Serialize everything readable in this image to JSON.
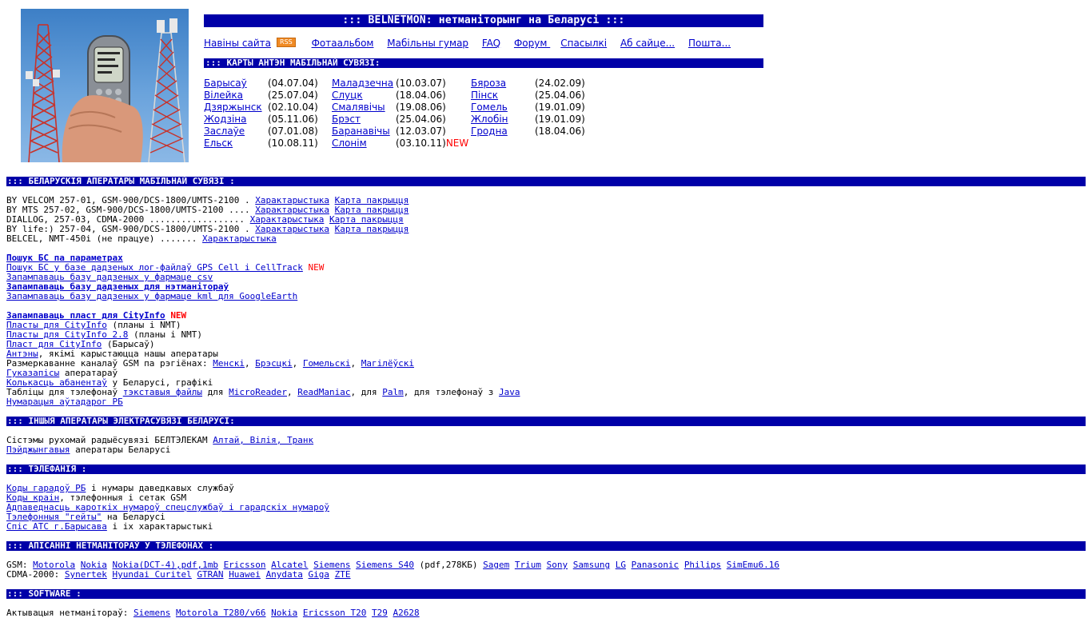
{
  "header": {
    "title": "::: BELNETMON: нетманіторынг на Беларусі :::",
    "nav": [
      "Навіны сайта",
      "Фотаальбом",
      "Мабільны гумар",
      "FAQ",
      "Форум ",
      "Спасылкі",
      "Аб сайце...",
      "Пошта..."
    ],
    "rss_label": "RSS",
    "maps_title": "::: КАРТЫ АНТЭН МАБІЛЬНАЙ СУВЯЗІ:"
  },
  "cities": {
    "col1": [
      {
        "name": "Барысаў",
        "date": "(04.07.04)"
      },
      {
        "name": "Вілейка",
        "date": "(25.07.04)"
      },
      {
        "name": "Дзяржынск",
        "date": "(02.10.04)"
      },
      {
        "name": "Жодзіна",
        "date": "(05.11.06)"
      },
      {
        "name": "Заслаўе",
        "date": "(07.01.08)"
      },
      {
        "name": "Ельск",
        "date": "(10.08.11)"
      }
    ],
    "col2": [
      {
        "name": "Маладзечна",
        "date": "(10.03.07)"
      },
      {
        "name": "Слуцк",
        "date": "(18.04.06)"
      },
      {
        "name": "Смалявічы",
        "date": "(19.08.06)"
      },
      {
        "name": "Брэст",
        "date": "(25.04.06)"
      },
      {
        "name": "Баранавічы",
        "date": "(12.03.07)"
      },
      {
        "name": "Слонім",
        "date": "(03.10.11)"
      }
    ],
    "col3": [
      {
        "name": "Бяроза",
        "date": "(24.02.09)"
      },
      {
        "name": "Пінск",
        "date": "(25.04.06)"
      },
      {
        "name": "Гомель",
        "date": "(19.01.09)"
      },
      {
        "name": "Жлобін",
        "date": "(19.01.09)"
      },
      {
        "name": "Гродна",
        "date": "(18.04.06)"
      }
    ],
    "new_label": "NEW"
  },
  "operators": {
    "title": "::: БЕЛАРУСКІЯ АПЕРАТАРЫ МАБІЛЬНАЙ СУВЯЗІ :",
    "rows": [
      {
        "text": "BY VELCOM 257-01, GSM-900/DCS-1800/UMTS-2100 . ",
        "link1": "Характарыстыка",
        "link2": "Карта пакрыцця"
      },
      {
        "text": "BY MTS 257-02, GSM-900/DCS-1800/UMTS-2100 .... ",
        "link1": "Характарыстыка",
        "link2": "Карта пакрыцця"
      },
      {
        "text": "DIALLOG, 257-03, CDMA-2000 .................. ",
        "link1": "Характарыстыка",
        "link2": "Карта пакрыцця"
      },
      {
        "text": "BY life:) 257-04, GSM-900/DCS-1800/UMTS-2100 . ",
        "link1": "Характарыстыка",
        "link2": "Карта пакрыцця"
      },
      {
        "text": "BELCEL, NMT-450i (не працуе) ....... ",
        "link1": "Характарыстыка",
        "link2": ""
      }
    ],
    "search1": "Пошук БС па параметрах",
    "search2": "Пошук БС у базе дадзеных лог-файлаў GPS Cell і CellTrack",
    "csv": "Запампаваць базу дадзеных у фармаце csv",
    "netmon_db": "Запампаваць базу дадзеных для нэтманітораў",
    "kml": "Запампаваць базу дадзеных у фармаце kml для GoogleEarth",
    "cityinfo_dl": "Запампаваць пласт для CityInfo",
    "layers1_link": "Пласты для CityInfo",
    "layers1_text": " (планы і NMT)",
    "layers2_link": "Пласты для CityInfo 2.8",
    "layers2_text": " (планы і NMT)",
    "layer3_link": "Пласт для CityInfo",
    "layer3_text": " (Барысаў)",
    "antennas_link": "Антэны",
    "antennas_text": ", якімі карыстаюцца нашы аператары",
    "channels_text": "Размеркаванне каналаў GSM па рэгіёнах: ",
    "channels": [
      "Менскі",
      "Брэсцкі",
      "Гомельскі",
      "Магілёўскі"
    ],
    "sound_link": "Гуказапісы",
    "sound_text": " аператараў",
    "subs_link": "Колькасць абанентаў",
    "subs_text": " у Беларусі, графікі",
    "tables_text1": "Табліцы для тэлефонаў ",
    "tables_link1": "тэкставыя файлы",
    "tables_text2": " для ",
    "tables_link2": "MicroReader",
    "tables_link3": "ReadManiac",
    "tables_text3": ", для ",
    "tables_link4": "Palm",
    "tables_text4": ", для тэлефонаў з ",
    "tables_link5": "Java",
    "roads": "Нумарацыя аўтадарог РБ"
  },
  "other": {
    "title": "::: ІНШЫЯ АПЕРАТАРЫ ЭЛЕКТРАСУВЯЗІ БЕЛАРУСІ:",
    "line1_text": "Сістэмы рухомай радыёсувязі БЕЛТЭЛЕКАМ ",
    "line1_link": "Алтай, Вілія, Транк",
    "line2_link": "Пэйджынгавыя",
    "line2_text": " аператары Беларусі"
  },
  "telephony": {
    "title": "::: ТЭЛЕФАНІЯ :",
    "rows": [
      {
        "link": "Коды гарадоў РБ",
        "text": " і нумары даведкавых службаў"
      },
      {
        "link": "Коды краін",
        "text": ", тэлефонныя і сетак GSM"
      },
      {
        "link": "Адпаведнасць кароткіх нумароў спецслужбаў і гарадскіх нумароў",
        "text": ""
      },
      {
        "link": "Тэлефонныя \"гейты\"",
        "text": " на Беларусі"
      },
      {
        "link": "Спіс АТС г.Барысава",
        "text": " і іх характарыстыкі"
      }
    ]
  },
  "netmon": {
    "title": "::: АПІСАННІ НЕТМАНІТОРАЎ У ТЭЛЕФОНАХ :",
    "gsm_label": "GSM: ",
    "gsm": [
      "Motorola",
      "Nokia",
      "Nokia(DCT-4),pdf,1mb",
      "Ericsson",
      "Alcatel",
      "Siemens",
      "Siemens S40"
    ],
    "gsm_mid": " (pdf,278КБ) ",
    "gsm2": [
      "Sagem",
      "Trium",
      "Sony",
      "Samsung",
      "LG",
      "Panasonic",
      "Philips",
      "SimEmu6.16"
    ],
    "cdma_label": "CDMA-2000: ",
    "cdma": [
      "Synertek",
      "Hyundai Curitel",
      "GTRAN",
      "Huawei",
      "Anydata",
      "Giga",
      "ZTE"
    ]
  },
  "software": {
    "title": "::: SOFTWARE :",
    "line_text": "Актывацыя нетманітораў: ",
    "links": [
      "Siemens",
      "Motorola T280/v66",
      "Nokia",
      "Ericsson T20",
      "T29",
      "A2628"
    ]
  }
}
